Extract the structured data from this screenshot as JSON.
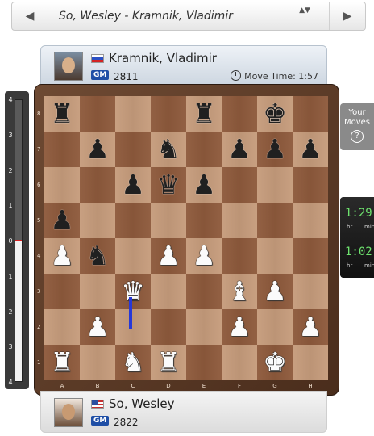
{
  "game_selector": {
    "title": "So, Wesley - Kramnik, Vladimir",
    "prev_icon": "◀",
    "next_icon": "▶",
    "updown_icon": "▲▼"
  },
  "top_player": {
    "name": "Kramnik, Vladimir",
    "title": "GM",
    "rating": "2811",
    "move_time_label": "Move Time: 1:57",
    "flag": "ru"
  },
  "bottom_player": {
    "name": "So, Wesley",
    "title": "GM",
    "rating": "2822",
    "flag": "us"
  },
  "eval_bar": {
    "ticks": [
      "4",
      "3",
      "2",
      "1",
      "0",
      "1",
      "2",
      "3",
      "4"
    ],
    "value": 0.0
  },
  "board": {
    "ranks": [
      "8",
      "7",
      "6",
      "5",
      "4",
      "3",
      "2",
      "1"
    ],
    "files": [
      "A",
      "B",
      "C",
      "D",
      "E",
      "F",
      "G",
      "H"
    ],
    "position": [
      [
        "r",
        "",
        "",
        "",
        "r",
        "",
        "k",
        ""
      ],
      [
        "",
        "p",
        "",
        "n",
        "",
        "p",
        "p",
        "p"
      ],
      [
        "",
        "",
        "p",
        "q",
        "p",
        "",
        "",
        ""
      ],
      [
        "p",
        "",
        "",
        "",
        "",
        "",
        "",
        ""
      ],
      [
        "P",
        "n",
        "",
        "P",
        "P",
        "",
        "",
        ""
      ],
      [
        "",
        "",
        "Q",
        "",
        "",
        "B",
        "P",
        ""
      ],
      [
        "",
        "P",
        "",
        "",
        "",
        "P",
        "",
        "P"
      ],
      [
        "R",
        "",
        "N",
        "R",
        "",
        "",
        "K",
        ""
      ]
    ],
    "colors": {
      "light": "#c69c7c",
      "dark": "#8e5a3c",
      "arrow": "#2638d8"
    }
  },
  "side_widgets": {
    "your_moves_line1": "Your",
    "your_moves_line2": "Moves",
    "help_icon": "?",
    "clock_top": "1:29",
    "clock_bottom": "1:02",
    "clock_unit_hr": "hr",
    "clock_unit_min": "min"
  }
}
